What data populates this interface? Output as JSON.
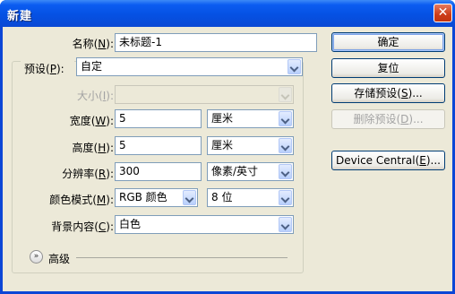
{
  "window": {
    "title": "新建",
    "close_glyph": "✕"
  },
  "form": {
    "name": {
      "label": "名称(",
      "key": "N",
      "suffix": "):",
      "value": "未标题-1"
    },
    "preset": {
      "label": "预设(",
      "key": "P",
      "suffix": "):",
      "value": "自定"
    },
    "size": {
      "label": "大小(",
      "key": "I",
      "suffix": "):",
      "value": ""
    },
    "width": {
      "label": "宽度(",
      "key": "W",
      "suffix": "):",
      "value": "5",
      "unit": "厘米"
    },
    "height": {
      "label": "高度(",
      "key": "H",
      "suffix": "):",
      "value": "5",
      "unit": "厘米"
    },
    "resolution": {
      "label": "分辨率(",
      "key": "R",
      "suffix": "):",
      "value": "300",
      "unit": "像素/英寸"
    },
    "color_mode": {
      "label": "颜色模式(",
      "key": "M",
      "suffix": "):",
      "value": "RGB 颜色",
      "depth": "8 位"
    },
    "background": {
      "label": "背景内容(",
      "key": "C",
      "suffix": "):",
      "value": "白色"
    },
    "advanced": {
      "label": "高级",
      "icon": "expand-chevrons-icon",
      "glyph": "»"
    }
  },
  "buttons": {
    "ok": "确定",
    "reset": "复位",
    "save_pre": "存储预设(",
    "save_key": "S",
    "save_post": ")...",
    "delete_pre": "删除预设(",
    "delete_key": "D",
    "delete_post": ")...",
    "device_pre": "Device Central(",
    "device_key": "E",
    "device_post": ")..."
  },
  "colors": {
    "titlebar": "#0551e3",
    "client": "#ece9d8",
    "field_border": "#7f9db9",
    "close": "#cc3c18"
  }
}
